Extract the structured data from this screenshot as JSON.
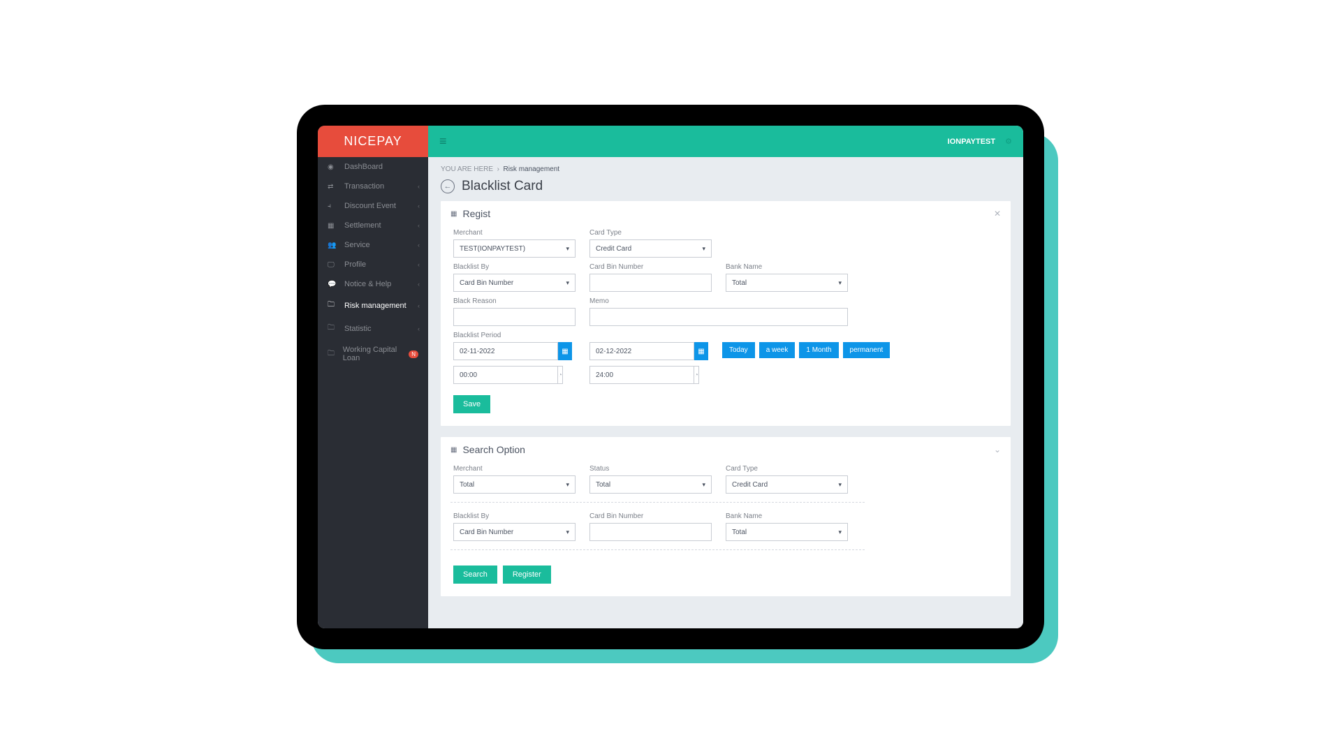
{
  "brand": "NICEPAY",
  "topbar": {
    "user": "IONPAYTEST"
  },
  "breadcrumb": {
    "prefix": "YOU ARE HERE",
    "current": "Risk management"
  },
  "page": {
    "title": "Blacklist Card"
  },
  "sidebar": {
    "items": [
      {
        "label": "DashBoard",
        "icon": "dashboard"
      },
      {
        "label": "Transaction",
        "icon": "transaction",
        "expandable": true
      },
      {
        "label": "Discount Event",
        "icon": "chart",
        "expandable": true
      },
      {
        "label": "Settlement",
        "icon": "calendar",
        "expandable": true
      },
      {
        "label": "Service",
        "icon": "users",
        "expandable": true
      },
      {
        "label": "Profile",
        "icon": "monitor",
        "expandable": true
      },
      {
        "label": "Notice & Help",
        "icon": "comment",
        "expandable": true
      },
      {
        "label": "Risk management",
        "icon": "folder",
        "expandable": true,
        "active": true
      },
      {
        "label": "Statistic",
        "icon": "folder",
        "expandable": true
      },
      {
        "label": "Working Capital Loan",
        "icon": "folder",
        "badge": "N"
      }
    ]
  },
  "regist": {
    "title": "Regist",
    "labels": {
      "merchant": "Merchant",
      "card_type": "Card Type",
      "blacklist_by": "Blacklist By",
      "card_bin_number": "Card Bin Number",
      "bank_name": "Bank Name",
      "black_reason": "Black Reason",
      "memo": "Memo",
      "blacklist_period": "Blacklist Period"
    },
    "values": {
      "merchant": "TEST(IONPAYTEST)",
      "card_type": "Credit Card",
      "blacklist_by": "Card Bin Number",
      "card_bin_number": "",
      "bank_name": "Total",
      "black_reason": "",
      "memo": "",
      "date_from": "02-11-2022",
      "date_to": "02-12-2022",
      "time_from": "00:00",
      "time_to": "24:00"
    },
    "quick": {
      "today": "Today",
      "week": "a week",
      "month": "1 Month",
      "permanent": "permanent"
    },
    "save": "Save"
  },
  "search": {
    "title": "Search Option",
    "labels": {
      "merchant": "Merchant",
      "status": "Status",
      "card_type": "Card Type",
      "blacklist_by": "Blacklist By",
      "card_bin_number": "Card Bin Number",
      "bank_name": "Bank Name"
    },
    "values": {
      "merchant": "Total",
      "status": "Total",
      "card_type": "Credit Card",
      "blacklist_by": "Card Bin Number",
      "card_bin_number": "",
      "bank_name": "Total"
    },
    "buttons": {
      "search": "Search",
      "register": "Register"
    }
  }
}
